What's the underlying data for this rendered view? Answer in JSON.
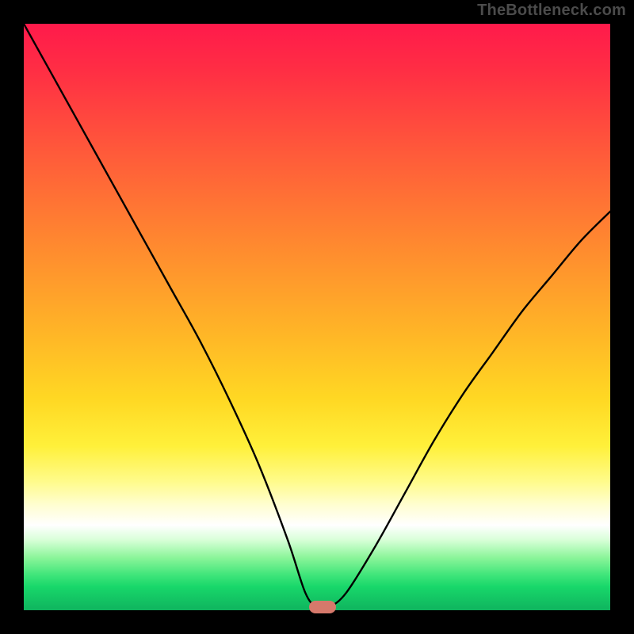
{
  "watermark": "TheBottleneck.com",
  "colors": {
    "marker": "#d6796b",
    "curve_stroke": "#000000"
  },
  "chart_data": {
    "type": "line",
    "title": "",
    "xlabel": "",
    "ylabel": "",
    "xlim": [
      0,
      100
    ],
    "ylim": [
      0,
      100
    ],
    "grid": false,
    "legend": false,
    "background_gradient_stops": [
      {
        "pos": 0,
        "color": "#ff1a4b"
      },
      {
        "pos": 8,
        "color": "#ff2e44"
      },
      {
        "pos": 22,
        "color": "#ff5a3a"
      },
      {
        "pos": 38,
        "color": "#ff8a2f"
      },
      {
        "pos": 52,
        "color": "#ffb327"
      },
      {
        "pos": 64,
        "color": "#ffd823"
      },
      {
        "pos": 72,
        "color": "#fff03a"
      },
      {
        "pos": 78,
        "color": "#fffb8a"
      },
      {
        "pos": 82,
        "color": "#fffed0"
      },
      {
        "pos": 85.5,
        "color": "#ffffff"
      },
      {
        "pos": 88,
        "color": "#d8ffd8"
      },
      {
        "pos": 91,
        "color": "#8cf59a"
      },
      {
        "pos": 94,
        "color": "#3fe57a"
      },
      {
        "pos": 96,
        "color": "#18d76a"
      },
      {
        "pos": 100,
        "color": "#0fb45e"
      }
    ],
    "series": [
      {
        "name": "bottleneck-curve",
        "x": [
          0,
          5,
          10,
          15,
          20,
          25,
          30,
          35,
          40,
          45,
          48,
          50,
          52,
          55,
          60,
          65,
          70,
          75,
          80,
          85,
          90,
          95,
          100
        ],
        "y": [
          100,
          91,
          82,
          73,
          64,
          55,
          46,
          36,
          25,
          12,
          3,
          0.5,
          0.5,
          3,
          11,
          20,
          29,
          37,
          44,
          51,
          57,
          63,
          68
        ]
      }
    ],
    "optimum_marker": {
      "x": 51,
      "y": 0.5
    }
  }
}
